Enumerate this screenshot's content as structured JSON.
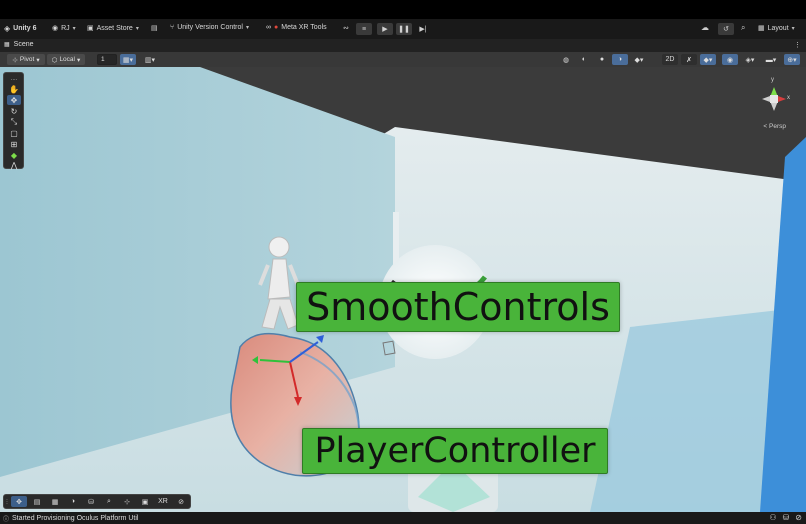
{
  "topbar": {
    "app_title": "Unity 6",
    "account": "RJ",
    "asset_store": "Asset Store",
    "version_control": "Unity Version Control",
    "meta_xr": "Meta XR Tools",
    "layout": "Layout",
    "icons": {
      "app": "unity-logo-icon",
      "account": "user-circle-icon",
      "store": "shopping-bag-icon",
      "package": "package-icon",
      "vc": "branch-icon",
      "meta": "meta-logo-icon",
      "xr": "headset-icon",
      "play": "play-icon",
      "pause": "pause-icon",
      "step": "step-icon",
      "cloud": "cloud-icon",
      "history": "history-icon",
      "search": "search-icon",
      "layout": "layout-grid-icon"
    }
  },
  "tabbar": {
    "scene_tab": "Scene",
    "more": "⋮"
  },
  "scenebar": {
    "pivot": "Pivot",
    "local": "Local",
    "grid_value": "1",
    "two_d": "2D"
  },
  "viewport": {
    "smooth_label": "SmoothControls",
    "player_label": "PlayerController",
    "persp_label": "< Persp",
    "gizmo": {
      "y": "y",
      "x": "x"
    },
    "bottom_xr": "XR"
  },
  "statusbar": {
    "message": "Started Provisioning Oculus Platform Util"
  },
  "colors": {
    "label_bg": "#49b43a",
    "selection_blue": "#3d5f8a",
    "wall_light": "#a9cfd8",
    "wall_blue": "#3a8fdc"
  }
}
